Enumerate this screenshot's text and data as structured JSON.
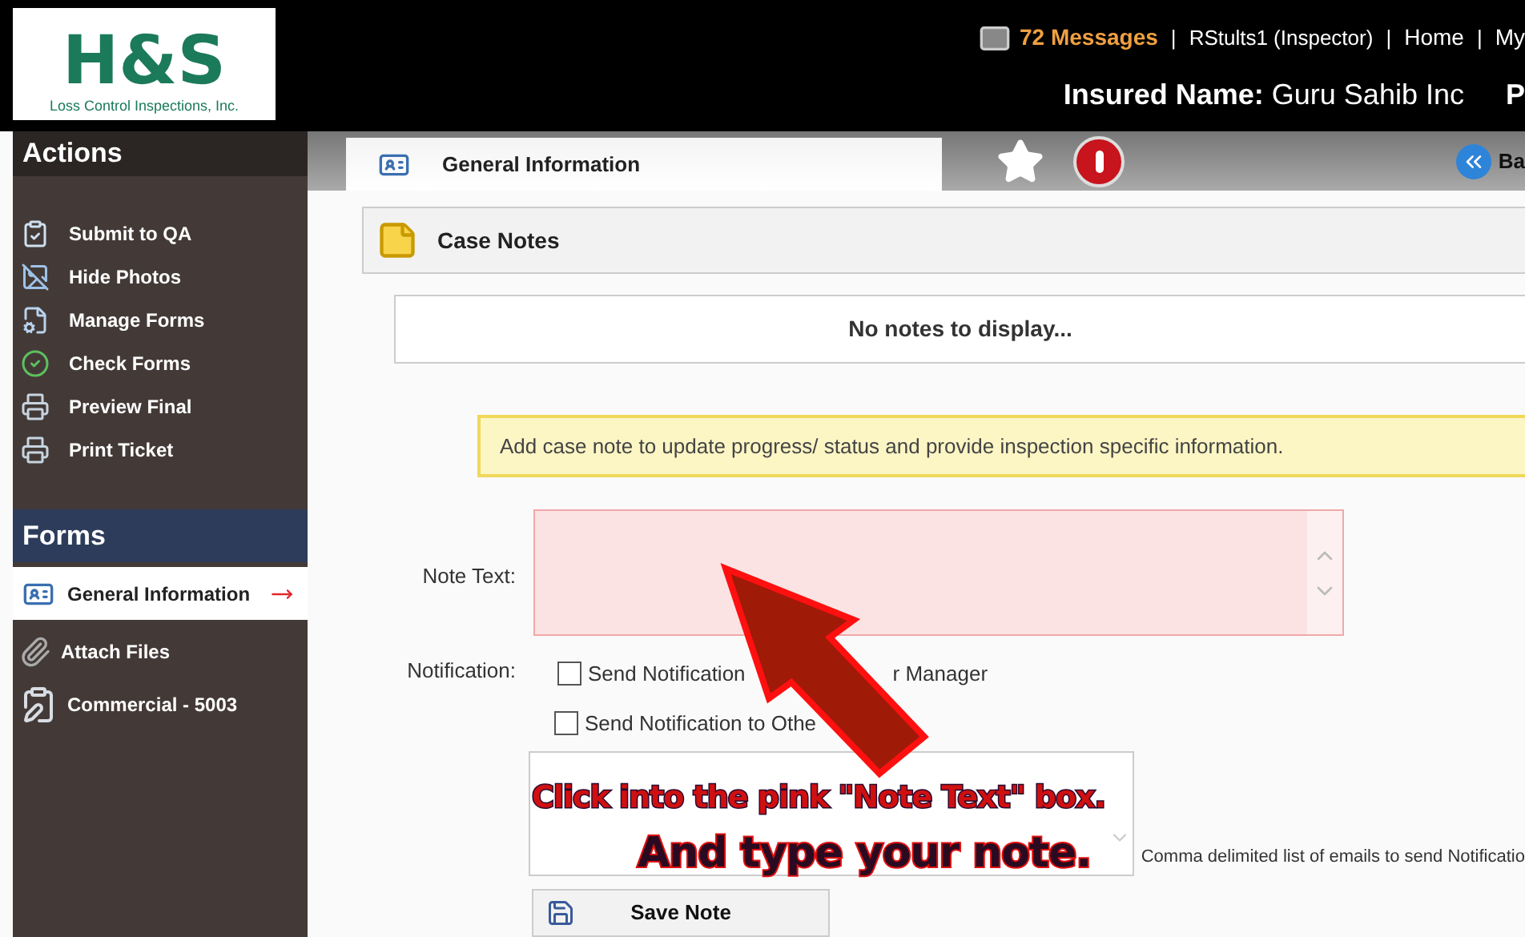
{
  "header": {
    "logo": {
      "mark": "H&S",
      "tagline": "Loss Control Inspections, Inc."
    },
    "messages": "72 Messages",
    "user": "RStults1 (Inspector)",
    "separator": "|",
    "links": [
      "Home",
      "My"
    ],
    "insured_label": "Insured Name:",
    "insured_value": "Guru Sahib Inc",
    "cut_text": "P"
  },
  "actions": {
    "title": "Actions",
    "items": [
      {
        "label": "Submit to QA",
        "kind": "submit"
      },
      {
        "label": "Hide Photos",
        "kind": "photos"
      },
      {
        "label": "Manage Forms",
        "kind": "manage"
      },
      {
        "label": "Check Forms",
        "kind": "check"
      },
      {
        "label": "Preview Final",
        "kind": "print"
      },
      {
        "label": "Print Ticket",
        "kind": "print"
      }
    ]
  },
  "forms": {
    "title": "Forms",
    "items": [
      {
        "label": "General Information",
        "kind": "id",
        "selected": true
      },
      {
        "label": "Attach Files",
        "kind": "clip",
        "selected": false
      },
      {
        "label": "Commercial - 5003",
        "kind": "form",
        "selected": false
      }
    ]
  },
  "tab": {
    "label": "General Information"
  },
  "back_button": "Ba",
  "case_notes": {
    "title": "Case Notes",
    "empty": "No notes to display...",
    "notice": "Add case note to update progress/ status and provide inspection specific information.",
    "note_label": "Note Text:",
    "notification_label": "Notification:",
    "checkboxes": [
      {
        "parts": [
          "Send Notification",
          "r Manager"
        ],
        "checked": false
      },
      {
        "parts": [
          "Send Notification to Othe"
        ],
        "checked": false
      }
    ],
    "emails_hint": "Comma delimited list of emails to send Notificatio",
    "save": "Save Note"
  },
  "overlay": {
    "line1": "Click into the pink \"Note Text\" box.",
    "line2": "And type your note."
  }
}
